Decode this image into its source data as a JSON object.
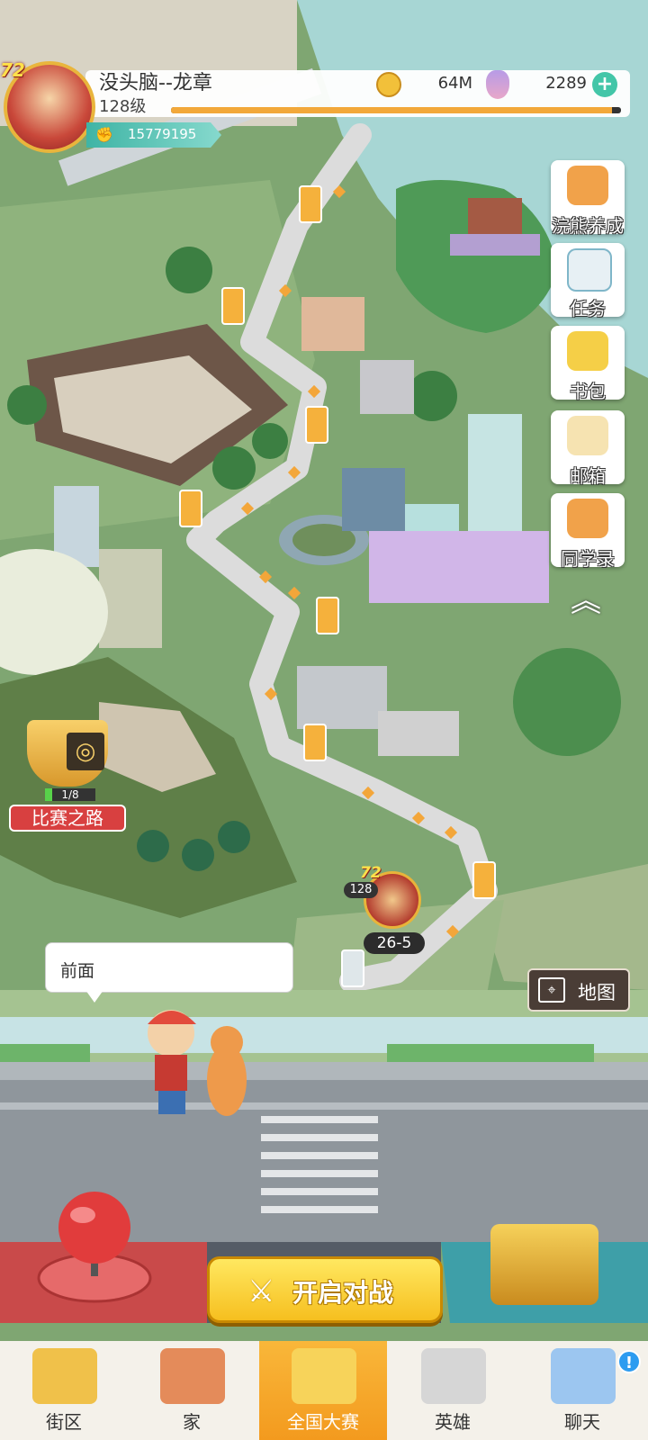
{
  "player": {
    "badge_level": "72",
    "name": "没头脑--龙章",
    "level": "128级",
    "power": "15779195",
    "xp_progress": 0.98
  },
  "currency": {
    "coins": "64M",
    "gems": "2289",
    "add_icon": "plus-icon"
  },
  "side_menu": [
    {
      "label": "浣熊养成",
      "icon": "raccoon-icon"
    },
    {
      "label": "任务",
      "icon": "clipboard-icon"
    },
    {
      "label": "书包",
      "icon": "backpack-icon"
    },
    {
      "label": "邮箱",
      "icon": "envelope-icon"
    },
    {
      "label": "同学录",
      "icon": "raccoon-book-icon"
    }
  ],
  "trophy": {
    "progress": "1/8",
    "label": "比赛之路"
  },
  "marker": {
    "badge": "72",
    "level": "128",
    "stage": "26-5"
  },
  "speech": "前面",
  "map_button": "地图",
  "start_button": "开启对战",
  "tabs": [
    {
      "label": "街区",
      "icon": "signpost-icon"
    },
    {
      "label": "家",
      "icon": "house-icon"
    },
    {
      "label": "全国大赛",
      "icon": "trophy-icon"
    },
    {
      "label": "英雄",
      "icon": "hero-cards-icon"
    },
    {
      "label": "聊天",
      "icon": "chat-bubble-icon"
    }
  ],
  "notification_badge": "!"
}
